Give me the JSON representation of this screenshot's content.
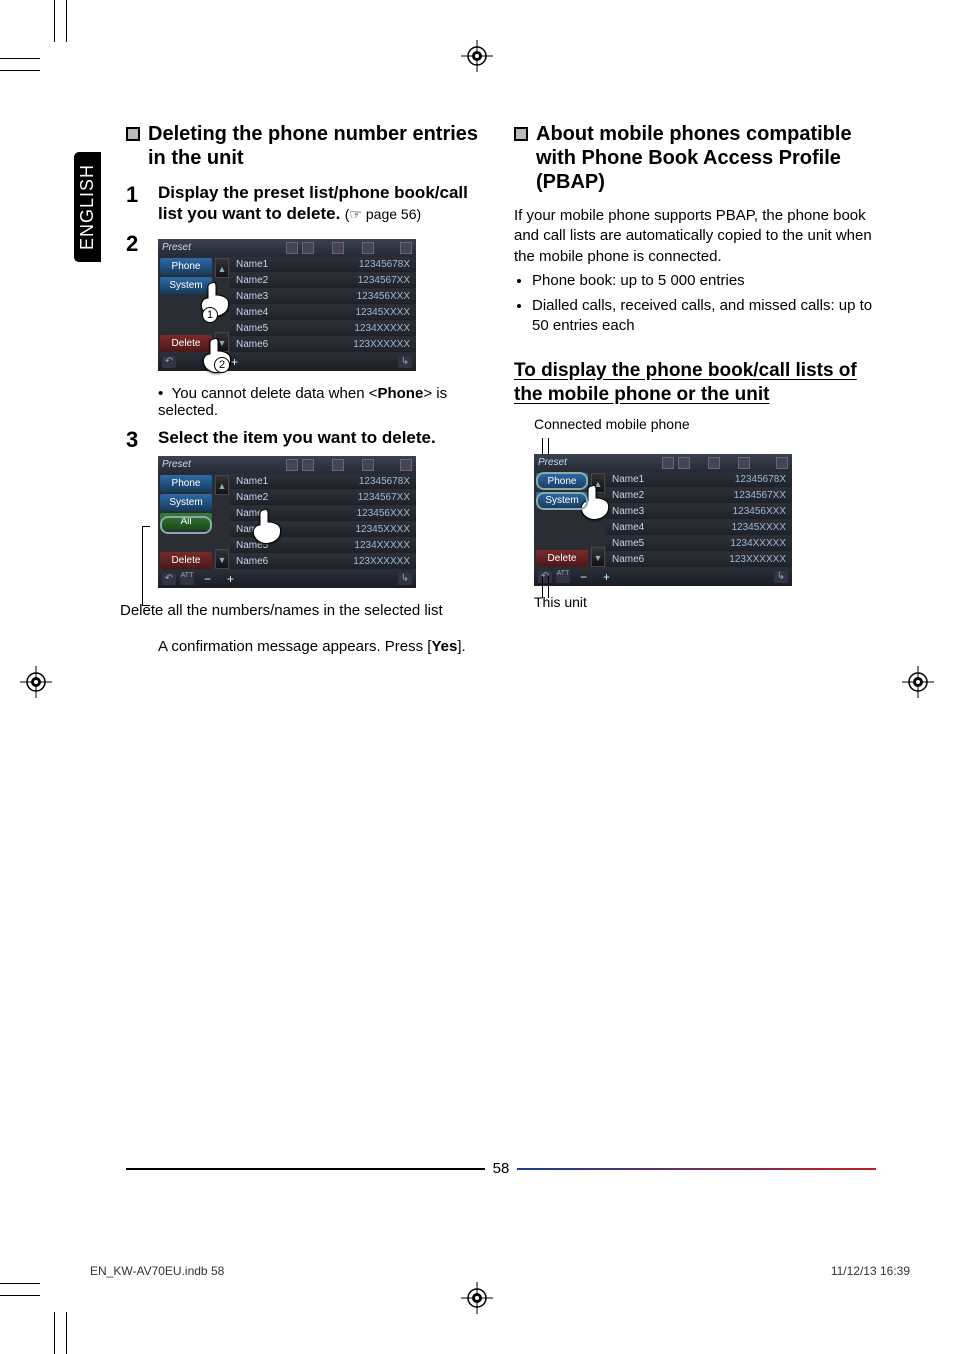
{
  "meta": {
    "lang_tab": "ENGLISH"
  },
  "left": {
    "section_title": "Deleting the phone number entries in the unit",
    "step1": {
      "num": "1",
      "text": "Display the preset list/phone book/call list you want to delete.",
      "ref": "(☞ page 56)"
    },
    "step2_num": "2",
    "device1": {
      "topbar": {
        "preset": "Preset"
      },
      "side": {
        "phone": "Phone",
        "system": "System",
        "delete": "Delete"
      },
      "arrows": {
        "up": "▲",
        "down": "▼"
      },
      "rows": [
        {
          "name": "Name1",
          "num": "12345678X"
        },
        {
          "name": "Name2",
          "num": "1234567XX"
        },
        {
          "name": "Name3",
          "num": "123456XXX"
        },
        {
          "name": "Name4",
          "num": "12345XXXX"
        },
        {
          "name": "Name5",
          "num": "1234XXXXX"
        },
        {
          "name": "Name6",
          "num": "123XXXXXX"
        }
      ],
      "circ1": "1",
      "circ2": "2"
    },
    "note_bullet": "You cannot delete data when <Phone> is selected.",
    "note_prefix": "•  ",
    "note_b_open": "<",
    "note_b_word": "Phone",
    "note_b_close": ">",
    "note_after": " is selected.",
    "note_before": "You cannot delete data when ",
    "step3": {
      "num": "3",
      "text": "Select the item you want to delete."
    },
    "device2": {
      "topbar": {
        "preset": "Preset"
      },
      "side": {
        "phone": "Phone",
        "system": "System",
        "all": "All",
        "delete": "Delete"
      },
      "rows": [
        {
          "name": "Name1",
          "num": "12345678X"
        },
        {
          "name": "Name2",
          "num": "1234567XX"
        },
        {
          "name": "Name3",
          "num": "123456XXX"
        },
        {
          "name": "Name4",
          "num": "12345XXXX"
        },
        {
          "name": "Name5",
          "num": "1234XXXXX"
        },
        {
          "name": "Name6",
          "num": "123XXXXXX"
        }
      ]
    },
    "delete_all_caption": "Delete all the numbers/names in the selected list",
    "confirm_text_pre": "A confirmation message appears. Press [",
    "confirm_bold": "Yes",
    "confirm_text_post": "]."
  },
  "right": {
    "section_title": "About mobile phones compatible with Phone Book Access Profile (PBAP)",
    "para": "If your mobile phone supports PBAP, the phone book and call lists are automatically copied to the unit when the mobile phone is connected.",
    "bullets": [
      "Phone book: up to 5 000 entries",
      "Dialled calls, received calls, and missed calls: up to 50 entries each"
    ],
    "sub_title": "To display the phone book/call lists of the mobile phone or the unit",
    "caption_top": "Connected mobile phone",
    "device": {
      "topbar": {
        "preset": "Preset"
      },
      "side": {
        "phone": "Phone",
        "system": "System",
        "delete": "Delete"
      },
      "arrows": {
        "up": "▲",
        "down": "▼"
      },
      "rows": [
        {
          "name": "Name1",
          "num": "12345678X"
        },
        {
          "name": "Name2",
          "num": "1234567XX"
        },
        {
          "name": "Name3",
          "num": "123456XXX"
        },
        {
          "name": "Name4",
          "num": "12345XXXX"
        },
        {
          "name": "Name5",
          "num": "1234XXXXX"
        },
        {
          "name": "Name6",
          "num": "123XXXXXX"
        }
      ]
    },
    "caption_bottom": "This unit"
  },
  "page_number": "58",
  "footer": {
    "file": "EN_KW-AV70EU.indb   58",
    "stamp": "11/12/13   16:39"
  }
}
